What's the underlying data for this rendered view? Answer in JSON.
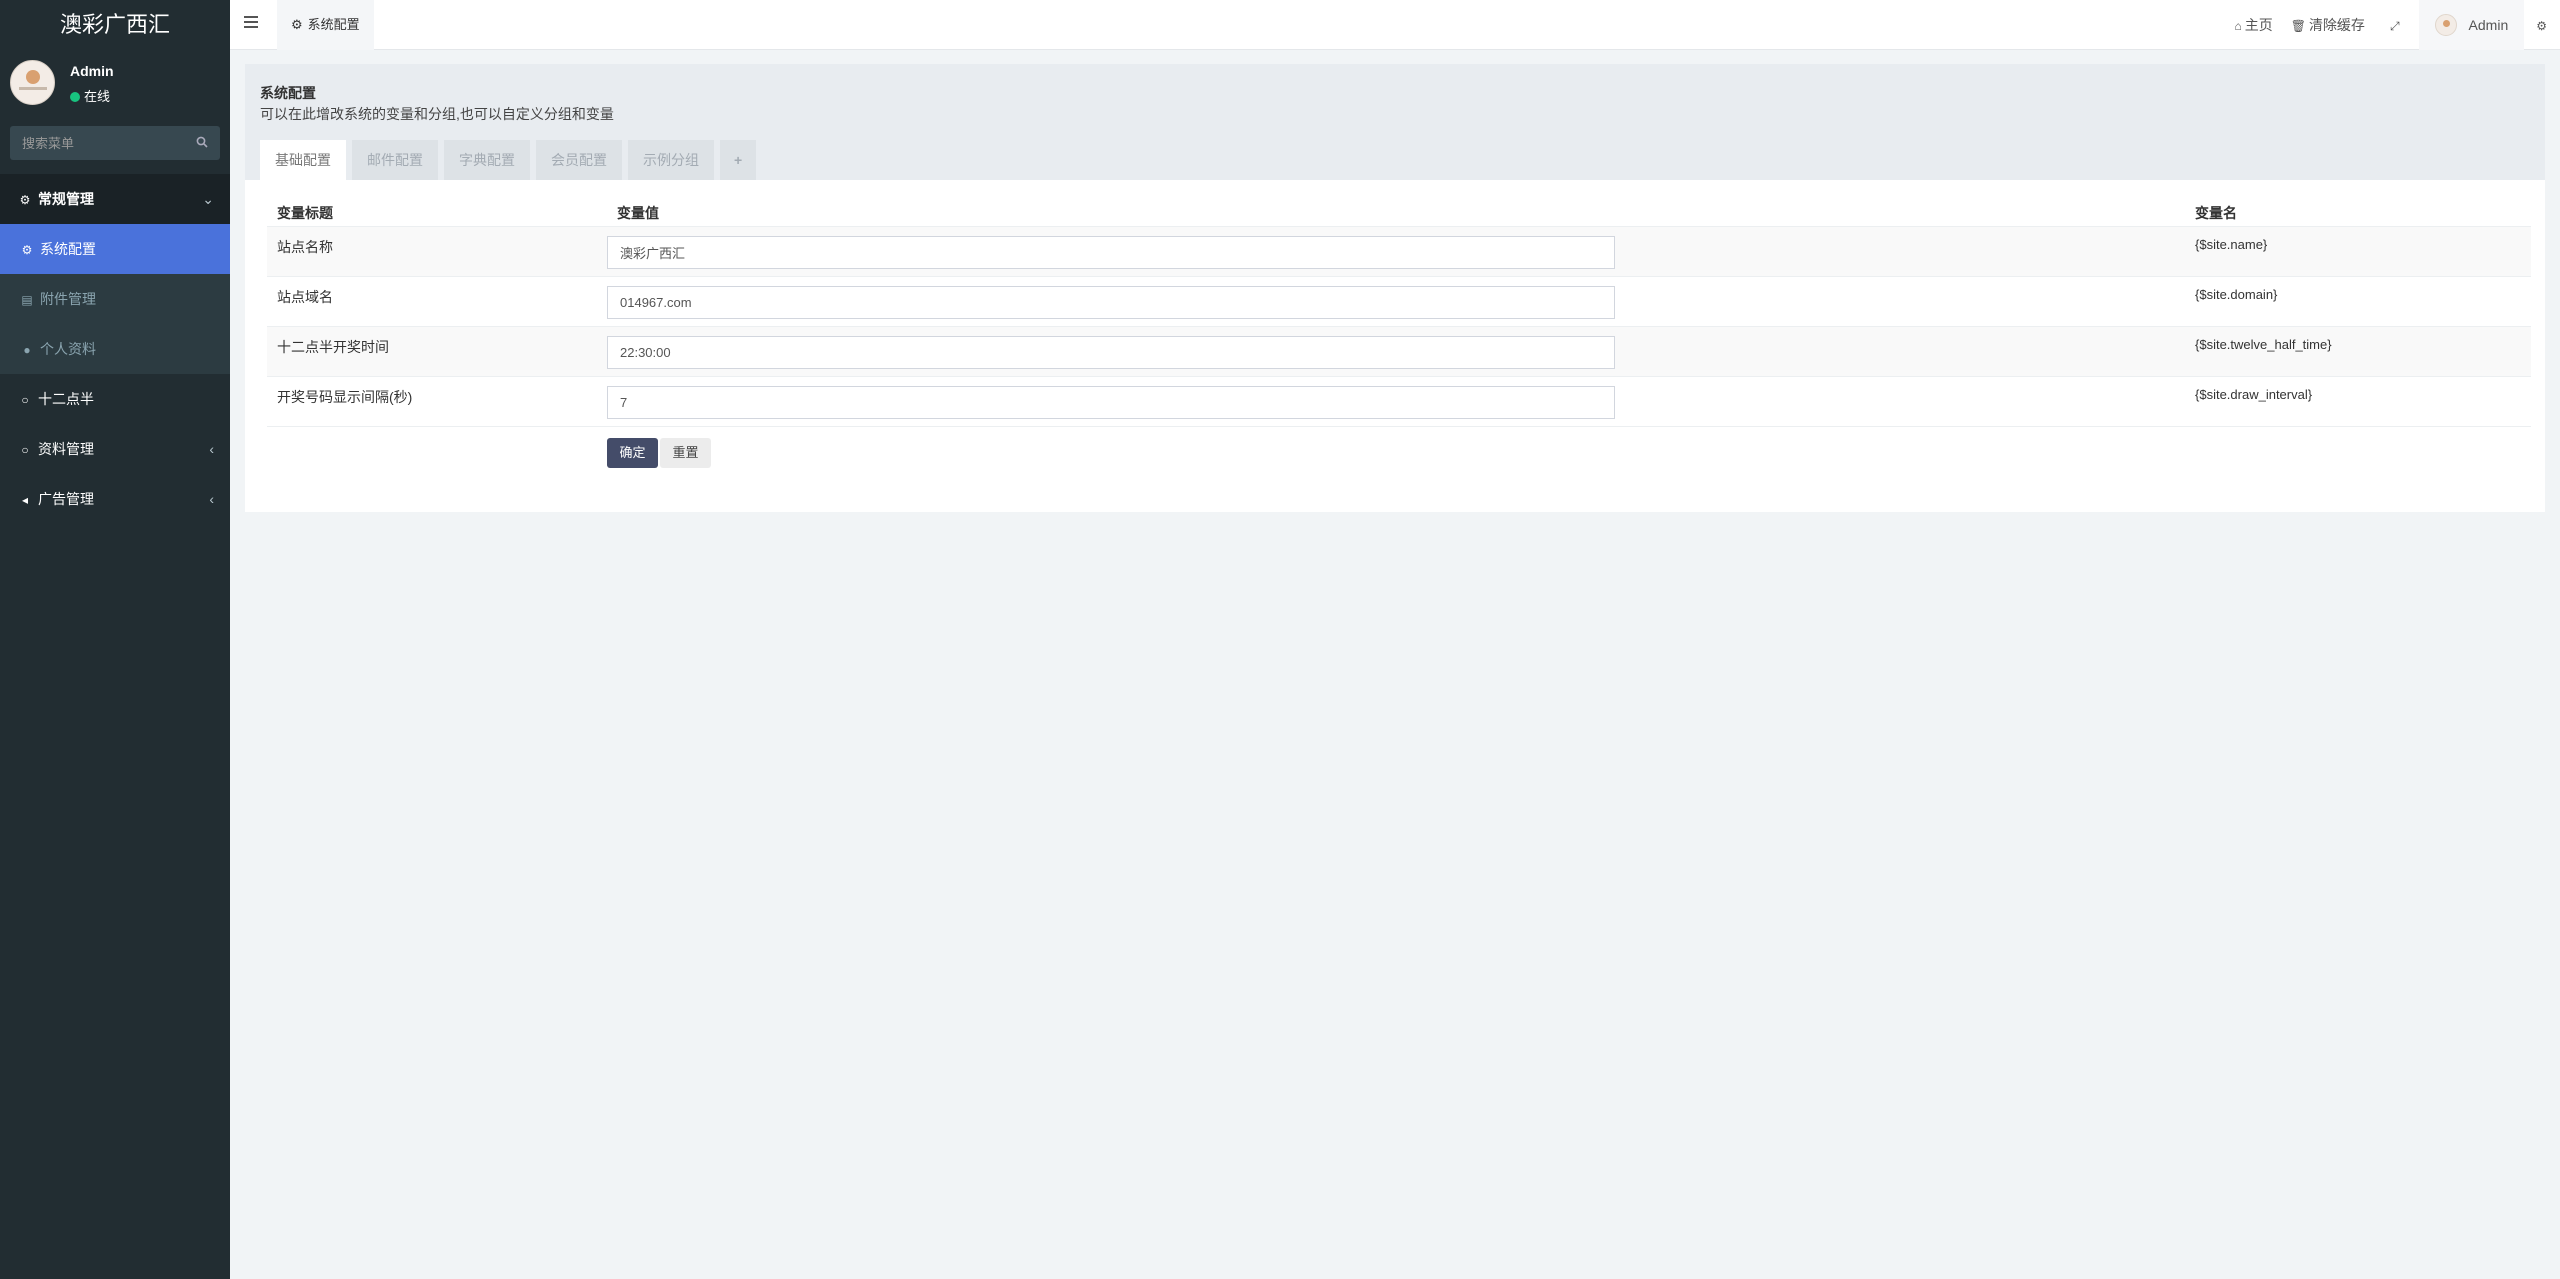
{
  "app": {
    "logo": "澳彩广西汇"
  },
  "user": {
    "name": "Admin",
    "status": "在线"
  },
  "search": {
    "placeholder": "搜索菜单"
  },
  "sidebar": {
    "group": {
      "label": "常规管理",
      "icon": "cogs-icon"
    },
    "sub_items": [
      {
        "label": "系统配置",
        "icon": "gear-icon",
        "active": true
      },
      {
        "label": "附件管理",
        "icon": "file-icon",
        "active": false
      },
      {
        "label": "个人资料",
        "icon": "user-icon",
        "active": false
      }
    ],
    "items": [
      {
        "label": "十二点半",
        "icon": "circle-icon"
      },
      {
        "label": "资料管理",
        "icon": "circle-icon"
      },
      {
        "label": "广告管理",
        "icon": "bullhorn-icon"
      }
    ]
  },
  "topbar": {
    "tab_label": "系统配置",
    "home": "主页",
    "clear_cache": "清除缓存",
    "user": "Admin"
  },
  "panel": {
    "title": "系统配置",
    "description": "可以在此增改系统的变量和分组,也可以自定义分组和变量",
    "tabs": [
      "基础配置",
      "邮件配置",
      "字典配置",
      "会员配置",
      "示例分组",
      "+"
    ],
    "headers": {
      "title": "变量标题",
      "value": "变量值",
      "name": "变量名"
    },
    "rows": [
      {
        "title": "站点名称",
        "value": "澳彩广西汇",
        "name": "{$site.name}"
      },
      {
        "title": "站点域名",
        "value": "014967.com",
        "name": "{$site.domain}"
      },
      {
        "title": "十二点半开奖时间",
        "value": "22:30:00",
        "name": "{$site.twelve_half_time}"
      },
      {
        "title": "开奖号码显示间隔(秒)",
        "value": "7",
        "name": "{$site.draw_interval}"
      }
    ],
    "buttons": {
      "ok": "确定",
      "reset": "重置"
    }
  },
  "colors": {
    "sidebar_bg": "#222d32",
    "active_item": "#4a72db",
    "primary_button": "#444c69"
  }
}
